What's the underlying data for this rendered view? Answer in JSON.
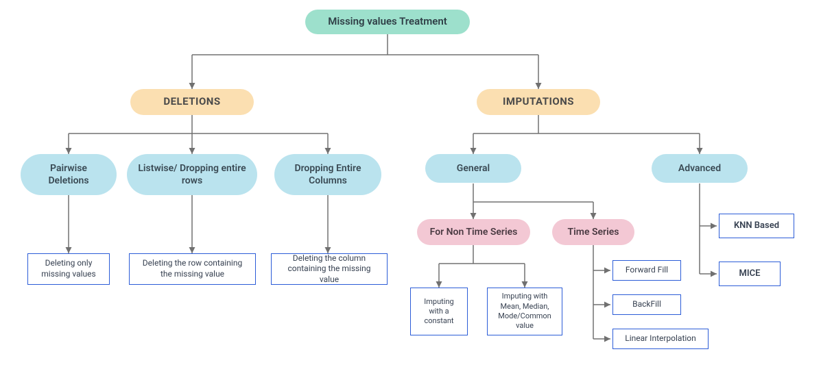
{
  "root": {
    "label": "Missing values Treatment"
  },
  "level1": {
    "deletions": {
      "label": "DELETIONS"
    },
    "imputations": {
      "label": "IMPUTATIONS"
    }
  },
  "deletions": {
    "pairwise": {
      "label": "Pairwise Deletions",
      "desc": "Deleting only missing values"
    },
    "listwise": {
      "label": "Listwise/ Dropping entire rows",
      "desc": "Deleting the row containing the missing value"
    },
    "columns": {
      "label": "Dropping Entire Columns",
      "desc": "Deleting the column containing the missing value"
    }
  },
  "imputations": {
    "general": {
      "label": "General"
    },
    "advanced": {
      "label": "Advanced"
    },
    "non_time_series": {
      "label": "For Non Time Series"
    },
    "time_series": {
      "label": "Time Series"
    },
    "impute_constant": {
      "label": "Imputing with a constant"
    },
    "impute_stats": {
      "label": "Imputing with Mean, Median, Mode/Common value"
    },
    "forward_fill": {
      "label": "Forward Fill"
    },
    "back_fill": {
      "label": "BackFill"
    },
    "linear_interp": {
      "label": "Linear Interpolation"
    },
    "knn": {
      "label": "KNN Based"
    },
    "mice": {
      "label": "MICE"
    }
  }
}
